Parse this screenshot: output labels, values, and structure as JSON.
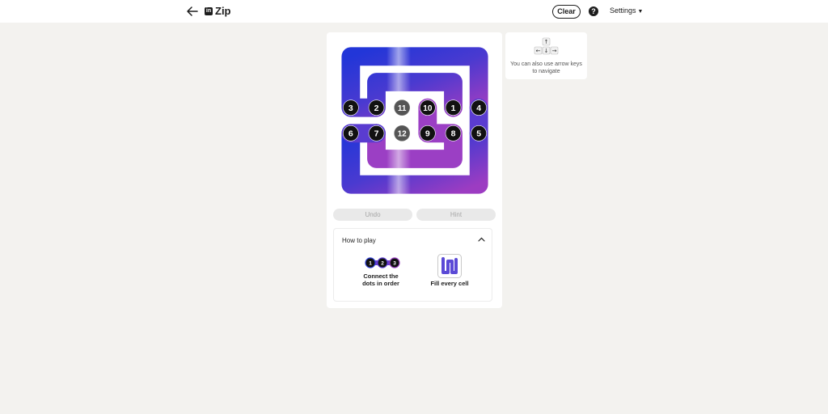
{
  "header": {
    "title": "Zip",
    "logo_letters": "in",
    "clear_label": "Clear",
    "help_label": "?",
    "settings_label": "Settings"
  },
  "board": {
    "rows": 6,
    "cols": 6,
    "cells": [
      {
        "label": "1",
        "row": 2,
        "col": 4,
        "filled": true
      },
      {
        "label": "2",
        "row": 2,
        "col": 1,
        "filled": true
      },
      {
        "label": "3",
        "row": 2,
        "col": 0,
        "filled": true
      },
      {
        "label": "4",
        "row": 2,
        "col": 5,
        "filled": true
      },
      {
        "label": "5",
        "row": 3,
        "col": 5,
        "filled": true
      },
      {
        "label": "6",
        "row": 3,
        "col": 0,
        "filled": true
      },
      {
        "label": "7",
        "row": 3,
        "col": 1,
        "filled": true
      },
      {
        "label": "8",
        "row": 3,
        "col": 4,
        "filled": true
      },
      {
        "label": "9",
        "row": 3,
        "col": 3,
        "filled": true
      },
      {
        "label": "10",
        "row": 2,
        "col": 3,
        "filled": true
      },
      {
        "label": "11",
        "row": 2,
        "col": 2,
        "filled": false
      },
      {
        "label": "12",
        "row": 3,
        "col": 2,
        "filled": false
      }
    ],
    "colors": {
      "path_blue": "#2f3fd6",
      "path_purple": "#9b3fc4",
      "dot": "#111111",
      "dot_faded": "#555555"
    }
  },
  "actions": {
    "undo_label": "Undo",
    "hint_label": "Hint"
  },
  "how_to_play": {
    "title": "How to play",
    "example_dots": [
      "1",
      "2",
      "3"
    ],
    "rule_1": "Connect the dots in order",
    "rule_2": "Fill every cell"
  },
  "tip": {
    "text": "You can also use arrow keys to navigate"
  }
}
